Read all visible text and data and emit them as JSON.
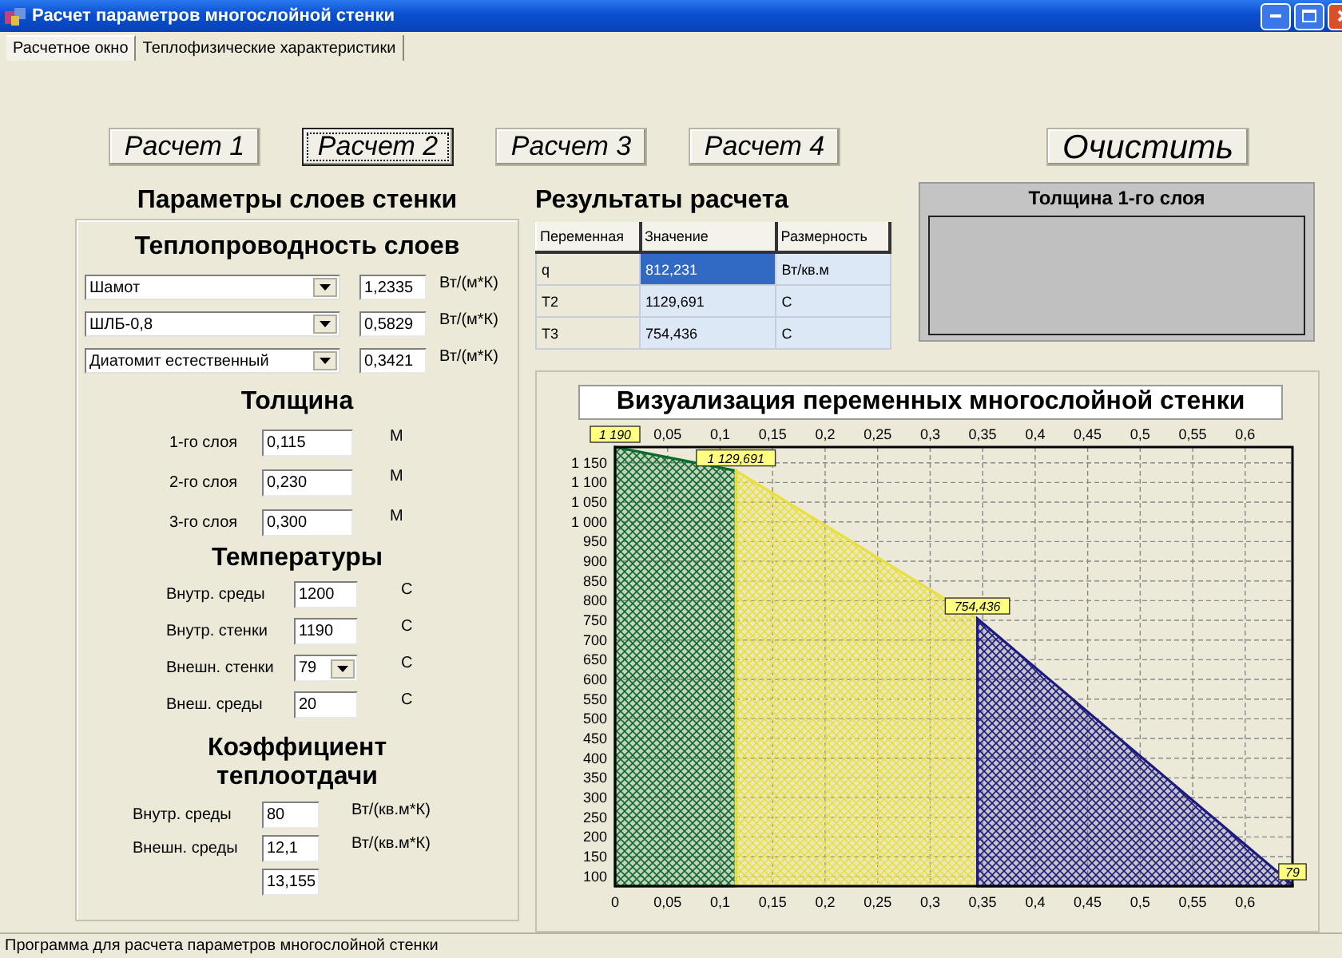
{
  "window": {
    "title": "Расчет параметров многослойной стенки"
  },
  "tabs": [
    {
      "label": "Расчетное окно",
      "selected": true
    },
    {
      "label": "Теплофизические характеристики",
      "selected": false
    }
  ],
  "calc_buttons": [
    {
      "label": "Расчет 1",
      "focused": false
    },
    {
      "label": "Расчет 2",
      "focused": true
    },
    {
      "label": "Расчет 3",
      "focused": false
    },
    {
      "label": "Расчет 4",
      "focused": false
    }
  ],
  "clear_button": {
    "label": "Очистить"
  },
  "params": {
    "title": "Параметры слоев стенки",
    "conductivity": {
      "title": "Теплопроводность слоев",
      "rows": [
        {
          "material": "Шамот",
          "value": "1,2335",
          "unit": "Вт/(м*К)"
        },
        {
          "material": "ШЛБ-0,8",
          "value": "0,5829",
          "unit": "Вт/(м*К)"
        },
        {
          "material": "Диатомит естественный",
          "value": "0,3421",
          "unit": "Вт/(м*К)"
        }
      ]
    },
    "thickness": {
      "title": "Толщина",
      "rows": [
        {
          "label": "1-го слоя",
          "value": "0,115",
          "unit": "М"
        },
        {
          "label": "2-го слоя",
          "value": "0,230",
          "unit": "М"
        },
        {
          "label": "3-го слоя",
          "value": "0,300",
          "unit": "М"
        }
      ]
    },
    "temperatures": {
      "title": "Температуры",
      "rows": [
        {
          "kind": "text",
          "label": "Внутр. среды",
          "value": "1200",
          "unit": "С"
        },
        {
          "kind": "text",
          "label": "Внутр. стенки",
          "value": "1190",
          "unit": "С"
        },
        {
          "kind": "combo",
          "label": "Внешн. стенки",
          "value": "79",
          "unit": "С"
        },
        {
          "kind": "text",
          "label": "Внеш. среды",
          "value": "20",
          "unit": "С"
        }
      ]
    },
    "heat_transfer": {
      "title": "Коэффициент теплоотдачи",
      "rows": [
        {
          "label": "Внутр. среды",
          "value": "80",
          "unit": "Вт/(кв.м*К)"
        },
        {
          "label": "Внешн. среды",
          "value": "12,1",
          "unit": "Вт/(кв.м*К)"
        },
        {
          "value": "13,155"
        }
      ]
    }
  },
  "results": {
    "title": "Результаты расчета",
    "columns": [
      "Переменная",
      "Значение",
      "Размерность"
    ],
    "rows": [
      {
        "cells": [
          "q",
          "812,231",
          "Вт/кв.м"
        ],
        "selected": true
      },
      {
        "cells": [
          "T2",
          "1129,691",
          "С"
        ],
        "selected": false
      },
      {
        "cells": [
          "T3",
          "754,436",
          "С"
        ],
        "selected": false
      }
    ]
  },
  "info_panel": {
    "title": "Толщина 1-го слоя"
  },
  "chart": {
    "chart_data": {
      "type": "area",
      "title": "Визуализация переменных многослойной стенки",
      "x": [
        0,
        0.115,
        0.345,
        0.645
      ],
      "series": [
        {
          "color": "#0b6b2e",
          "values": [
            1190,
            1130,
            null,
            null
          ]
        },
        {
          "color": "#e8e040",
          "values": [
            null,
            1130,
            754,
            null
          ]
        },
        {
          "color": "#1c1c80",
          "values": [
            null,
            null,
            754,
            79
          ]
        }
      ],
      "xlim": [
        0,
        0.645
      ],
      "ylim": [
        75,
        1190
      ],
      "grid": true,
      "xticks": [
        {
          "value": 0,
          "label": "0"
        },
        {
          "value": 0.05,
          "label": "0,05"
        },
        {
          "value": 0.1,
          "label": "0,1"
        },
        {
          "value": 0.15,
          "label": "0,15"
        },
        {
          "value": 0.2,
          "label": "0,2"
        },
        {
          "value": 0.25,
          "label": "0,25"
        },
        {
          "value": 0.3,
          "label": "0,3"
        },
        {
          "value": 0.35,
          "label": "0,35"
        },
        {
          "value": 0.4,
          "label": "0,4"
        },
        {
          "value": 0.45,
          "label": "0,45"
        },
        {
          "value": 0.5,
          "label": "0,5"
        },
        {
          "value": 0.55,
          "label": "0,55"
        },
        {
          "value": 0.6,
          "label": "0,6"
        }
      ],
      "yticks": [
        {
          "value": 100,
          "label": "100"
        },
        {
          "value": 150,
          "label": "150"
        },
        {
          "value": 200,
          "label": "200"
        },
        {
          "value": 250,
          "label": "250"
        },
        {
          "value": 300,
          "label": "300"
        },
        {
          "value": 350,
          "label": "350"
        },
        {
          "value": 400,
          "label": "400"
        },
        {
          "value": 450,
          "label": "450"
        },
        {
          "value": 500,
          "label": "500"
        },
        {
          "value": 550,
          "label": "550"
        },
        {
          "value": 600,
          "label": "600"
        },
        {
          "value": 650,
          "label": "650"
        },
        {
          "value": 700,
          "label": "700"
        },
        {
          "value": 750,
          "label": "750"
        },
        {
          "value": 800,
          "label": "800"
        },
        {
          "value": 850,
          "label": "850"
        },
        {
          "value": 900,
          "label": "900"
        },
        {
          "value": 950,
          "label": "950"
        },
        {
          "value": 1000,
          "label": "1 000"
        },
        {
          "value": 1050,
          "label": "1 050"
        },
        {
          "value": 1100,
          "label": "1 100"
        },
        {
          "value": 1150,
          "label": "1 150"
        }
      ],
      "annotations": [
        {
          "x": 0,
          "y": 1190,
          "text": "1 190"
        },
        {
          "x": 0.115,
          "y": 1130,
          "text": "1 129,691"
        },
        {
          "x": 0.345,
          "y": 754,
          "text": "754,436"
        },
        {
          "x": 0.645,
          "y": 79,
          "text": "79"
        }
      ]
    }
  },
  "status_bar": {
    "text": "Программа для расчета параметров многослойной стенки"
  }
}
